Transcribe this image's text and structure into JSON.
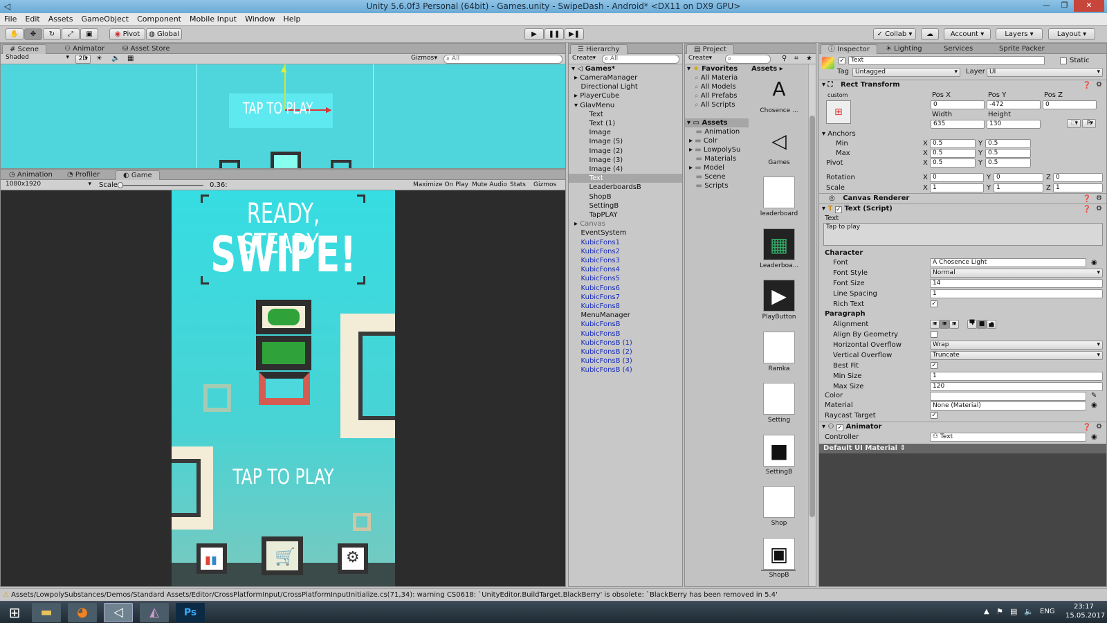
{
  "window": {
    "title": "Unity 5.6.0f3 Personal (64bit) - Games.unity - SwipeDash - Android* <DX11 on DX9 GPU>"
  },
  "menu": [
    "File",
    "Edit",
    "Assets",
    "GameObject",
    "Component",
    "Mobile Input",
    "Window",
    "Help"
  ],
  "toolbar": {
    "pivot": "Pivot",
    "global": "Global",
    "collab": "Collab",
    "account": "Account",
    "layers": "Layers",
    "layout": "Layout"
  },
  "scene": {
    "tabs": [
      "Scene",
      "Animator",
      "Asset Store"
    ],
    "shaded": "Shaded",
    "mode2d": "2D",
    "gizmos": "Gizmos",
    "search": "All",
    "tap_text": "TAP TO PLAY"
  },
  "game": {
    "tabs": [
      "Animation",
      "Profiler",
      "Game"
    ],
    "resolution": "1080x1920",
    "scale_label": "Scale",
    "scale_value": "0.36:",
    "options": [
      "Maximize On Play",
      "Mute Audio",
      "Stats",
      "Gizmos"
    ],
    "title_line1": "READY, STEADY,",
    "title_line2": "SWIPE!",
    "tap_text": "TAP TO PLAY"
  },
  "hierarchy": {
    "tab": "Hierarchy",
    "create": "Create",
    "search": "All",
    "root": "Games*",
    "items": [
      {
        "t": "CameraManager",
        "i": 1,
        "c": "n",
        "a": true
      },
      {
        "t": "Directional Light",
        "i": 1,
        "c": "n"
      },
      {
        "t": "PlayerCube",
        "i": 1,
        "c": "n",
        "a": true
      },
      {
        "t": "GlavMenu",
        "i": 1,
        "c": "n",
        "a": true
      },
      {
        "t": "Text",
        "i": 2,
        "c": "n"
      },
      {
        "t": "Text (1)",
        "i": 2,
        "c": "n"
      },
      {
        "t": "Image",
        "i": 2,
        "c": "n"
      },
      {
        "t": "Image (5)",
        "i": 2,
        "c": "n"
      },
      {
        "t": "Image (2)",
        "i": 2,
        "c": "n"
      },
      {
        "t": "Image (3)",
        "i": 2,
        "c": "n"
      },
      {
        "t": "Image (4)",
        "i": 2,
        "c": "n"
      },
      {
        "t": "Text",
        "i": 2,
        "c": "s"
      },
      {
        "t": "LeaderboardsB",
        "i": 2,
        "c": "n"
      },
      {
        "t": "ShopB",
        "i": 2,
        "c": "n"
      },
      {
        "t": "SettingB",
        "i": 2,
        "c": "n"
      },
      {
        "t": "TapPLAY",
        "i": 2,
        "c": "n"
      },
      {
        "t": "Canvas",
        "i": 1,
        "c": "g",
        "a": true
      },
      {
        "t": "EventSystem",
        "i": 1,
        "c": "n"
      },
      {
        "t": "KubicFons1",
        "i": 1,
        "c": "b"
      },
      {
        "t": "KubicFons2",
        "i": 1,
        "c": "b"
      },
      {
        "t": "KubicFons3",
        "i": 1,
        "c": "b"
      },
      {
        "t": "KubicFons4",
        "i": 1,
        "c": "b"
      },
      {
        "t": "KubicFons5",
        "i": 1,
        "c": "b"
      },
      {
        "t": "KubicFons6",
        "i": 1,
        "c": "b"
      },
      {
        "t": "KubicFons7",
        "i": 1,
        "c": "b"
      },
      {
        "t": "KubicFons8",
        "i": 1,
        "c": "b"
      },
      {
        "t": "MenuManager",
        "i": 1,
        "c": "n"
      },
      {
        "t": "KubicFonsB",
        "i": 1,
        "c": "b"
      },
      {
        "t": "KubicFonsB",
        "i": 1,
        "c": "b"
      },
      {
        "t": "KubicFonsB (1)",
        "i": 1,
        "c": "b"
      },
      {
        "t": "KubicFonsB (2)",
        "i": 1,
        "c": "b"
      },
      {
        "t": "KubicFonsB (3)",
        "i": 1,
        "c": "b"
      },
      {
        "t": "KubicFonsB (4)",
        "i": 1,
        "c": "b"
      }
    ]
  },
  "project": {
    "tab": "Project",
    "create": "Create",
    "favorites_label": "Favorites",
    "favorites": [
      "All Materia",
      "All Models",
      "All Prefabs",
      "All Scripts"
    ],
    "assets_label": "Assets",
    "folders": [
      "Animation",
      "Colr",
      "LowpolySu",
      "Materials",
      "Model",
      "Scene",
      "Scripts"
    ],
    "assets_header": "Assets",
    "assets": [
      "Chosence ...",
      "Games",
      "leaderboard",
      "Leaderboa...",
      "PlayButton",
      "Ramka",
      "Setting",
      "SettingB",
      "Shop",
      "ShopB"
    ]
  },
  "inspector": {
    "tabs": [
      "Inspector",
      "Lighting",
      "Services",
      "Sprite Packer"
    ],
    "name": "Text",
    "static": "Static",
    "tag_label": "Tag",
    "tag": "Untagged",
    "layer_label": "Layer",
    "layer": "UI",
    "rect": {
      "title": "Rect Transform",
      "custom": "custom",
      "posx_l": "Pos X",
      "posy_l": "Pos Y",
      "posz_l": "Pos Z",
      "posx": "0",
      "posy": "-472",
      "posz": "0",
      "width_l": "Width",
      "height_l": "Height",
      "width": "635",
      "height": "130",
      "r_btn": "R",
      "anchors": "Anchors",
      "min": "Min",
      "max": "Max",
      "pivot": "Pivot",
      "rotation": "Rotation",
      "scale": "Scale",
      "x": "X",
      "y": "Y",
      "z": "Z",
      "min_x": "0.5",
      "min_y": "0.5",
      "max_x": "0.5",
      "max_y": "0.5",
      "pivot_x": "0.5",
      "pivot_y": "0.5",
      "rot_x": "0",
      "rot_y": "0",
      "rot_z": "0",
      "sc_x": "1",
      "sc_y": "1",
      "sc_z": "1"
    },
    "canvas_renderer": "Canvas Renderer",
    "text_script": {
      "title": "Text (Script)",
      "text_label": "Text",
      "text_value": "Tap to play",
      "character": "Character",
      "font_l": "Font",
      "font": "Chosence Light",
      "style_l": "Font Style",
      "style": "Normal",
      "size_l": "Font Size",
      "size": "14",
      "spacing_l": "Line Spacing",
      "spacing": "1",
      "rich_l": "Rich Text",
      "paragraph": "Paragraph",
      "align_l": "Alignment",
      "geom_l": "Align By Geometry",
      "hover_l": "Horizontal Overflow",
      "hover": "Wrap",
      "vover_l": "Vertical Overflow",
      "vover": "Truncate",
      "bestfit_l": "Best Fit",
      "min_l": "Min Size",
      "min": "1",
      "max_l": "Max Size",
      "max": "120",
      "color_l": "Color",
      "material_l": "Material",
      "material": "None (Material)",
      "raycast_l": "Raycast Target"
    },
    "animator": {
      "title": "Animator",
      "controller_l": "Controller",
      "controller": "Text"
    },
    "material_bar": "Default UI Material"
  },
  "status": {
    "message": "Assets/LowpolySubstances/Demos/Standard Assets/Editor/CrossPlatformInput/CrossPlatformInputInitialize.cs(71,34): warning CS0618: `UnityEditor.BuildTarget.BlackBerry' is obsolete: `BlackBerry has been removed in 5.4'"
  },
  "taskbar": {
    "lang": "ENG",
    "time": "23:17",
    "date": "15.05.2017",
    "ps": "Ps"
  }
}
